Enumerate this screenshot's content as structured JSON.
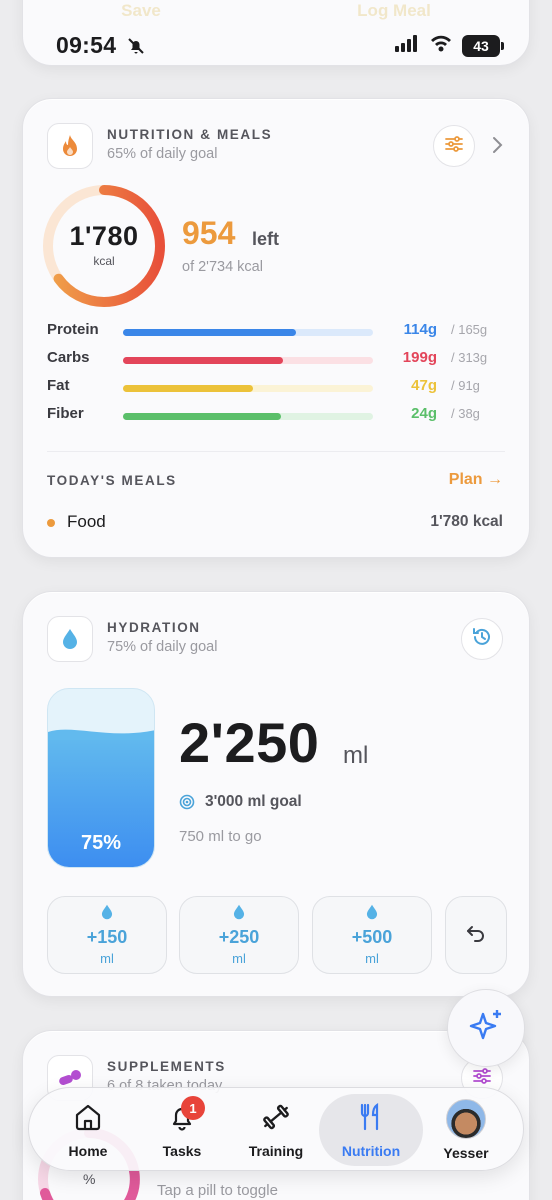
{
  "status_bar": {
    "time": "09:54",
    "battery": "43"
  },
  "top_card": {
    "save_label": "Save",
    "log_meal_label": "Log Meal"
  },
  "nutrition": {
    "title": "NUTRITION & MEALS",
    "subtitle": "65% of daily goal",
    "consumed": "1'780",
    "consumed_unit": "kcal",
    "consumed_fraction": 0.65,
    "left_value": "954",
    "left_word": "left",
    "of_total": "of 2'734 kcal",
    "macros": [
      {
        "label": "Protein",
        "value": "114g",
        "goal": "/ 165g",
        "fraction": 0.69,
        "color": "#3a86e8",
        "track": "#dbe9fb"
      },
      {
        "label": "Carbs",
        "value": "199g",
        "goal": "/ 313g",
        "fraction": 0.64,
        "color": "#e3455a",
        "track": "#fbe0e4"
      },
      {
        "label": "Fat",
        "value": "47g",
        "goal": "/ 91g",
        "fraction": 0.52,
        "color": "#ecc23a",
        "track": "#fbf3d6"
      },
      {
        "label": "Fiber",
        "value": "24g",
        "goal": "/ 38g",
        "fraction": 0.63,
        "color": "#5bbf6a",
        "track": "#e0f3e3"
      }
    ],
    "meals_title": "TODAY'S MEALS",
    "plan_label": "Plan →",
    "meals": [
      {
        "name": "Food",
        "kcal": "1'780 kcal"
      }
    ],
    "accent": "#ec9a3d"
  },
  "hydration": {
    "title": "HYDRATION",
    "subtitle": "75% of daily goal",
    "fill_fraction": 0.75,
    "fill_percent_label": "75%",
    "amount": "2'250",
    "unit": "ml",
    "goal": "3'000 ml goal",
    "to_go": "750 ml to go",
    "buttons": [
      {
        "amount": "+150",
        "unit": "ml"
      },
      {
        "amount": "+250",
        "unit": "ml"
      },
      {
        "amount": "+500",
        "unit": "ml"
      }
    ],
    "accent": "#4aa3d9"
  },
  "supplements": {
    "title": "SUPPLEMENTS",
    "subtitle": "6 of 8 taken today",
    "percent_symbol": "%",
    "hint": "Tap a pill to toggle",
    "accent": "#b34ed1"
  },
  "tabbar": {
    "items": [
      {
        "label": "Home",
        "icon": "home-icon"
      },
      {
        "label": "Tasks",
        "icon": "bell-icon",
        "badge": "1"
      },
      {
        "label": "Training",
        "icon": "dumbbell-icon"
      },
      {
        "label": "Nutrition",
        "icon": "fork-knife-icon",
        "active": true
      },
      {
        "label": "Yesser",
        "icon": "avatar"
      }
    ]
  }
}
